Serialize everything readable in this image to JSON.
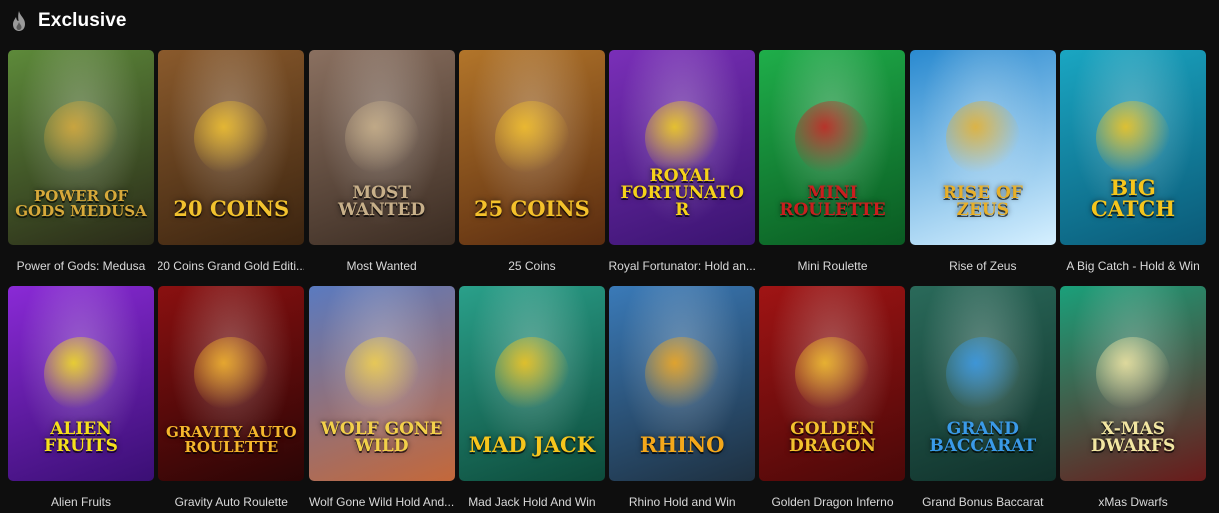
{
  "section": {
    "title": "Exclusive",
    "icon": "flame-icon"
  },
  "games": [
    {
      "name": "Power of Gods: Medusa",
      "logo": "POWER OF GODS MEDUSA",
      "bg1": "#5d8a3a",
      "bg2": "#2a2a18",
      "accent": "#d7a93a"
    },
    {
      "name": "20 Coins Grand Gold Editi...",
      "logo": "20 COINS",
      "bg1": "#8a5a2c",
      "bg2": "#3b2410",
      "accent": "#f2c22e"
    },
    {
      "name": "Most Wanted",
      "logo": "MOST WANTED",
      "bg1": "#8a7060",
      "bg2": "#3b2c22",
      "accent": "#c8b08a"
    },
    {
      "name": "25 Coins",
      "logo": "25 COINS",
      "bg1": "#b2752a",
      "bg2": "#5a2c10",
      "accent": "#f4c12b"
    },
    {
      "name": "Royal Fortunator: Hold an...",
      "logo": "ROYAL FORTUNATOR",
      "bg1": "#7a2fb8",
      "bg2": "#3a1470",
      "accent": "#f5d21a"
    },
    {
      "name": "Mini Roulette",
      "logo": "MINI ROULETTE",
      "bg1": "#1fae4a",
      "bg2": "#0a5a22",
      "accent": "#c91f1f"
    },
    {
      "name": "Rise of Zeus",
      "logo": "RISE OF ZEUS",
      "bg1": "#2a8ad0",
      "bg2": "#d6f0ff",
      "accent": "#e8b02a"
    },
    {
      "name": "A Big Catch - Hold & Win",
      "logo": "BIG CATCH",
      "bg1": "#1aa6c2",
      "bg2": "#0b5a78",
      "accent": "#f6c51c"
    },
    {
      "name": "Alien Fruits",
      "logo": "ALIEN FRUITS",
      "bg1": "#8a2ad6",
      "bg2": "#3a0f74",
      "accent": "#f6e11c"
    },
    {
      "name": "Gravity Auto Roulette",
      "logo": "GRAVITY AUTO ROULETTE",
      "bg1": "#8a1010",
      "bg2": "#2a0505",
      "accent": "#f5b72c"
    },
    {
      "name": "Wolf Gone Wild Hold And...",
      "logo": "WOLF GONE WILD",
      "bg1": "#5a7ac0",
      "bg2": "#c4683a",
      "accent": "#f2d04a"
    },
    {
      "name": "Mad Jack Hold And Win",
      "logo": "MAD JACK",
      "bg1": "#2aa08a",
      "bg2": "#0d4a3a",
      "accent": "#f6c51c"
    },
    {
      "name": "Rhino Hold and Win",
      "logo": "RHINO",
      "bg1": "#3a7ab8",
      "bg2": "#1e3040",
      "accent": "#f5a81a"
    },
    {
      "name": "Golden Dragon Inferno",
      "logo": "GOLDEN DRAGON",
      "bg1": "#a01414",
      "bg2": "#4a0808",
      "accent": "#f3c22e"
    },
    {
      "name": "Grand Bonus Baccarat",
      "logo": "GRAND BACCARAT",
      "bg1": "#2a6a5a",
      "bg2": "#10302a",
      "accent": "#3a9ae8"
    },
    {
      "name": "xMas Dwarfs",
      "logo": "X-MAS DWARFS",
      "bg1": "#1aa07a",
      "bg2": "#6a1a1a",
      "accent": "#f2e6a2"
    }
  ]
}
